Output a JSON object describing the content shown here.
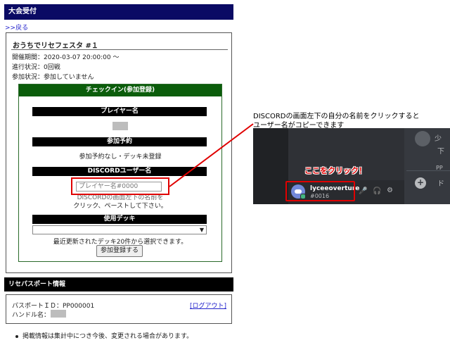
{
  "header": {
    "title": "大会受付"
  },
  "nav": {
    "back_link": ">>戻る"
  },
  "event": {
    "title": "おうちでリセフェスタ #１",
    "period": "開催期間：2020-03-07 20:00:00 ～",
    "progress": "進行状況：0回戦",
    "participation": "参加状況：参加していません"
  },
  "checkin": {
    "header": "チェックイン(参加登録)",
    "player_name_label": "プレイヤー名",
    "reservation_label": "参加予約",
    "reservation_value": "参加予約なし・デッキ未登録",
    "discord_label": "DISCORDユーザー名",
    "discord_placeholder": "プレイヤー名#0000",
    "discord_help_1": "DISCORDの画面左下の名前を",
    "discord_help_2": "クリック、ペーストして下さい。",
    "deck_label": "使用デッキ",
    "deck_note": "最近更新されたデッキ20件から選択できます。",
    "submit_label": "参加登録する"
  },
  "passport": {
    "header": "リセパスポート情報",
    "id_line": "パスポートＩＤ：PP000001",
    "handle_label": "ハンドル名：",
    "logout_label": "[ログアウト]"
  },
  "footnote": "掲載情報は集計中につき今後、変更される場合があります。",
  "callout": {
    "line1": "DISCORDの画面左下の自分の名前をクリックすると",
    "line2": "ユーザー名がコピーできます",
    "click_label": "ここをクリック！",
    "discord_username": "lyceeoverture",
    "discord_tag": "#0016"
  },
  "colors": {
    "header_navy": "#0a0a64",
    "checkin_green": "#0b5d0b",
    "highlight_red": "#e00000",
    "discord_dark": "#2f3136",
    "discord_blurple": "#7289da"
  }
}
